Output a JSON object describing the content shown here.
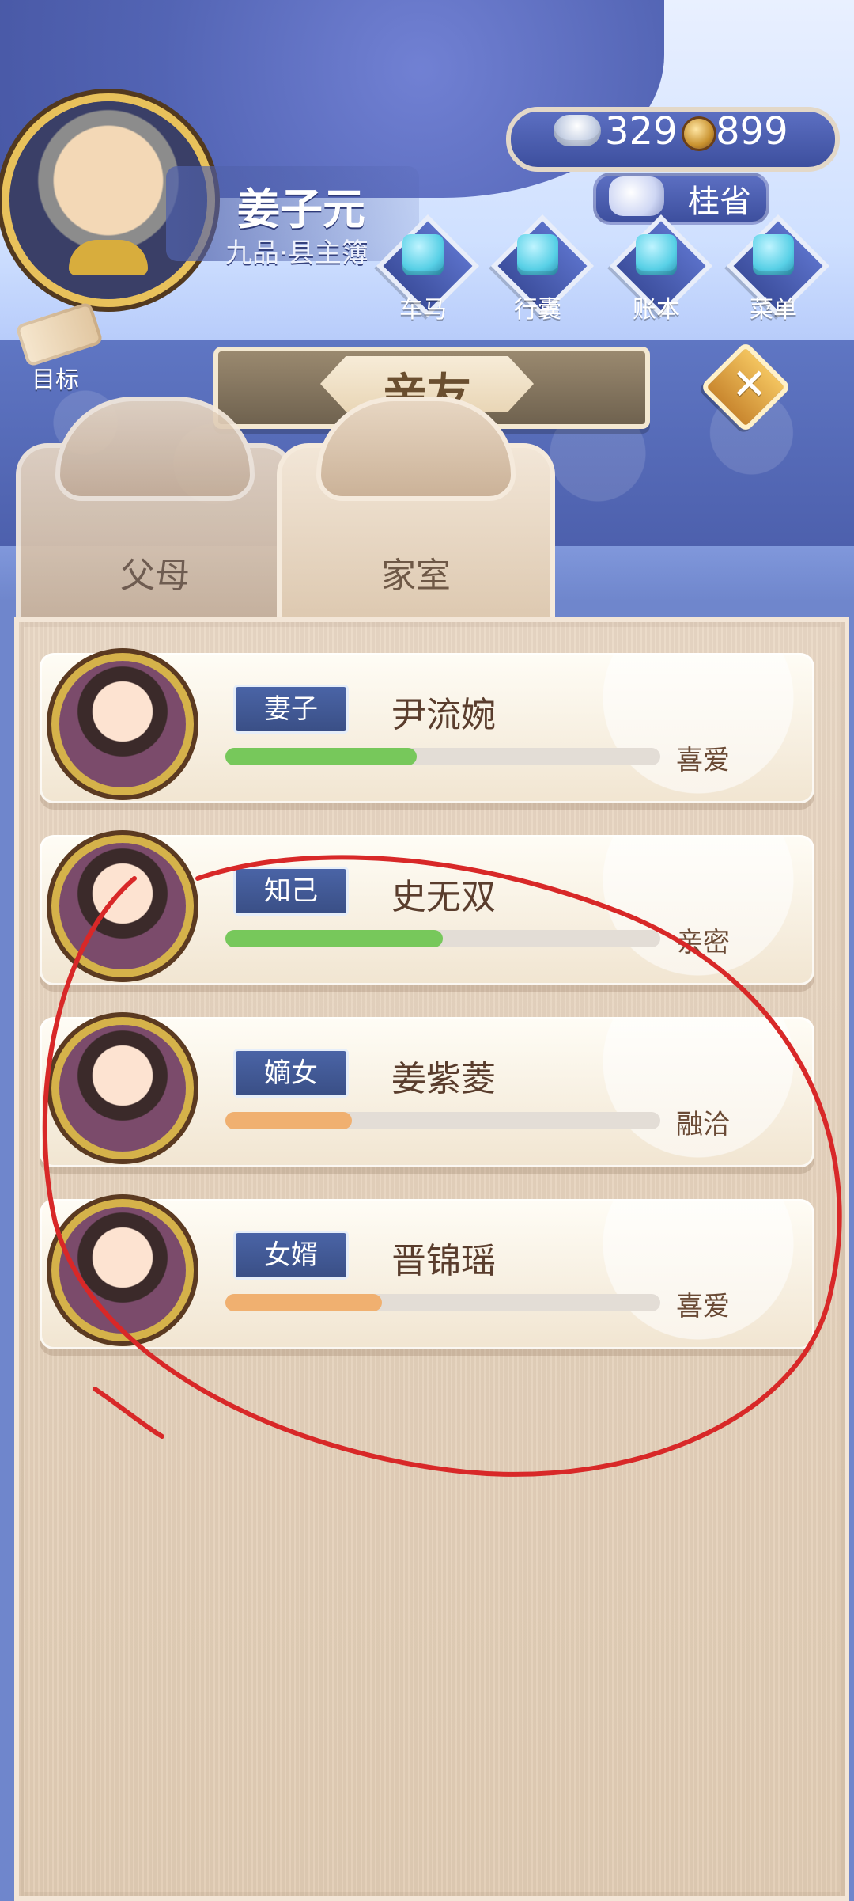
{
  "header": {
    "player_name": "姜子元",
    "player_rank": "九品·县主簿",
    "currency": {
      "silver": "329",
      "coins": "899"
    },
    "status_label": "桂省",
    "goal_label": "目标"
  },
  "menu": {
    "items": [
      {
        "label": "车马",
        "icon": "carriage-icon"
      },
      {
        "label": "行囊",
        "icon": "bundle-icon"
      },
      {
        "label": "账本",
        "icon": "ledger-icon"
      },
      {
        "label": "菜单",
        "icon": "menu-icon"
      }
    ]
  },
  "title": {
    "text": "亲友"
  },
  "tabs": [
    {
      "label": "父母",
      "active": false
    },
    {
      "label": "家室",
      "active": true
    }
  ],
  "relatives": [
    {
      "tag": "妻子",
      "name": "尹流婉",
      "relation": "喜爱",
      "progress": 0.44,
      "bar_color": "#77c85b"
    },
    {
      "tag": "知己",
      "name": "史无双",
      "relation": "亲密",
      "progress": 0.5,
      "bar_color": "#77c85b"
    },
    {
      "tag": "嫡女",
      "name": "姜紫菱",
      "relation": "融洽",
      "progress": 0.29,
      "bar_color": "#f0b070"
    },
    {
      "tag": "女婿",
      "name": "晋锦瑶",
      "relation": "喜爱",
      "progress": 0.36,
      "bar_color": "#f0b070"
    }
  ],
  "colors": {
    "annotation_red": "#d82828"
  }
}
